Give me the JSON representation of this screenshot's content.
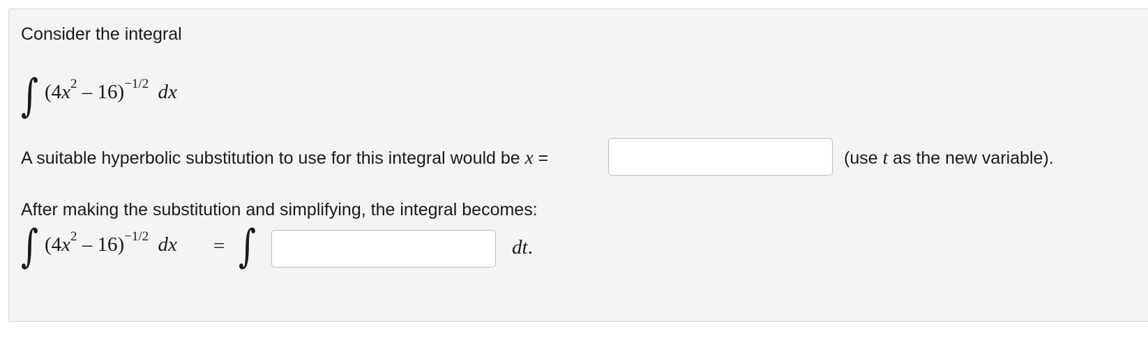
{
  "problem": {
    "intro": "Consider the integral",
    "integral_sign": "∫",
    "integrand": {
      "open": "(4",
      "var": "x",
      "exp2": "2",
      "minus_part": " – 16)",
      "outer_exp": "−1/2",
      "diff": "dx"
    },
    "substitution": {
      "text_before": "A suitable hyperbolic substitution to use for this integral would be ",
      "var": "x",
      "equals": " =",
      "input_value": "",
      "note_open": "(use ",
      "note_var": "t",
      "note_close": " as the new variable)."
    },
    "simplify": {
      "intro": "After making the substitution and simplifying, the integral becomes:",
      "equals": "=",
      "input_value": "",
      "dt": "dt",
      "period": "."
    }
  }
}
